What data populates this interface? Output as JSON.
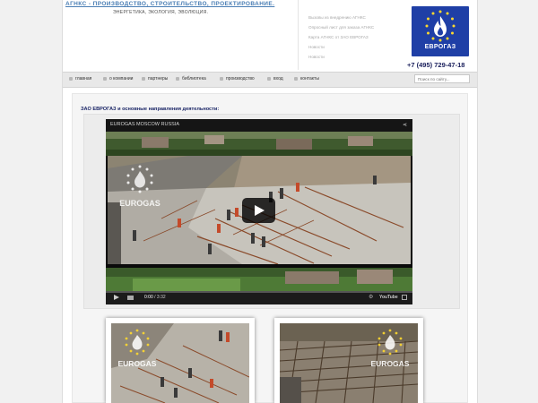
{
  "header": {
    "tagline": "АГНКС - ПРОИЗВОДСТВО, СТРОИТЕЛЬСТВО, ПРОЕКТИРОВАНИЕ.",
    "subtagline": "ЭНЕРГЕТИКА, ЭКОЛОГИЯ, ЭВОЛЮЦИЯ.",
    "news": [
      "Вызовы из внедрению АГНКС",
      "Опросный лист для заказа АГНКС",
      "Карта АГНКС от ЗАО ЕВРОГАЗ",
      "Новости",
      "Новости"
    ],
    "logo_text": "ЕВРОГАЗ",
    "phone": "+7 (495) 729-47-18"
  },
  "nav": {
    "items": [
      "главная",
      "о компании",
      "партнеры",
      "библиотека",
      "производство",
      "вход",
      "контакты"
    ],
    "search_placeholder": "Поиск по сайту..."
  },
  "content": {
    "title": "ЗАО ЕВРОГАЗ и основные направления деятельности:"
  },
  "video": {
    "title": "EUROGAS MOSCOW RUSSIA",
    "current_time": "0:00",
    "duration": "/ 3:32",
    "progress_fraction": 0,
    "watermark": "EUROGAS",
    "youtube_label": "YouTube"
  },
  "thumbnails": [
    {
      "watermark": "EUROGAS"
    },
    {
      "watermark": "EUROGAS"
    }
  ],
  "colors": {
    "brand_blue": "#1f3fa6",
    "tagline": "#4a7eb4",
    "star_yellow": "#ffd92e",
    "title_navy": "#1a2566"
  }
}
